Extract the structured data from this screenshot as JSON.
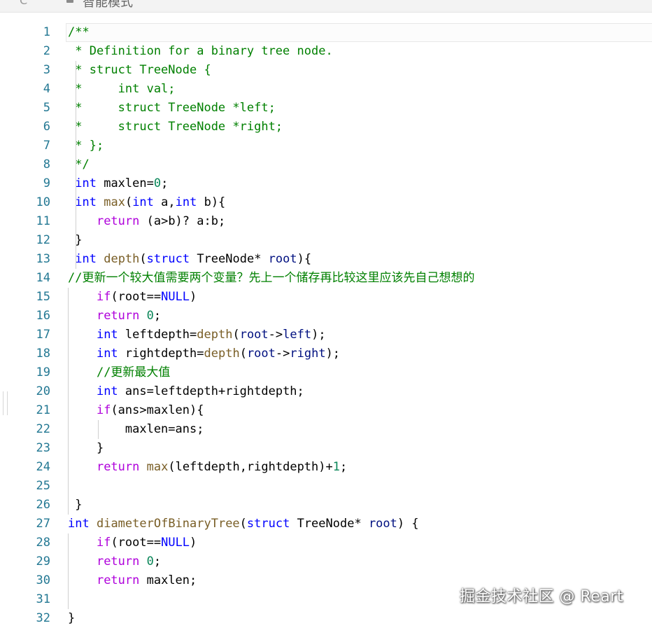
{
  "toolbar": {
    "back_glyph": "C",
    "mode_label": "智能模式"
  },
  "line_numbers": [
    "1",
    "2",
    "3",
    "4",
    "5",
    "6",
    "7",
    "8",
    "9",
    "10",
    "11",
    "12",
    "13",
    "14",
    "15",
    "16",
    "17",
    "18",
    "19",
    "20",
    "21",
    "22",
    "23",
    "24",
    "25",
    "26",
    "27",
    "28",
    "29",
    "30",
    "31",
    "32"
  ],
  "code_lines": [
    [
      {
        "t": "/**",
        "c": "cm"
      }
    ],
    [
      {
        "t": " * Definition for a binary tree node.",
        "c": "cm"
      }
    ],
    [
      {
        "t": " * struct TreeNode {",
        "c": "cm"
      }
    ],
    [
      {
        "t": " *     int val;",
        "c": "cm"
      }
    ],
    [
      {
        "t": " *     struct TreeNode *left;",
        "c": "cm"
      }
    ],
    [
      {
        "t": " *     struct TreeNode *right;",
        "c": "cm"
      }
    ],
    [
      {
        "t": " * };",
        "c": "cm"
      }
    ],
    [
      {
        "t": " */",
        "c": "cm"
      }
    ],
    [
      {
        "t": " "
      },
      {
        "t": "int",
        "c": "kw"
      },
      {
        "t": " maxlen="
      },
      {
        "t": "0",
        "c": "nu"
      },
      {
        "t": ";"
      }
    ],
    [
      {
        "t": " "
      },
      {
        "t": "int",
        "c": "kw"
      },
      {
        "t": " "
      },
      {
        "t": "max",
        "c": "fn"
      },
      {
        "t": "("
      },
      {
        "t": "int",
        "c": "kw"
      },
      {
        "t": " a,"
      },
      {
        "t": "int",
        "c": "kw"
      },
      {
        "t": " b){"
      }
    ],
    [
      {
        "t": "    "
      },
      {
        "t": "return",
        "c": "ck"
      },
      {
        "t": " (a>b)? a:b;"
      }
    ],
    [
      {
        "t": " }"
      }
    ],
    [
      {
        "t": " "
      },
      {
        "t": "int",
        "c": "kw"
      },
      {
        "t": " "
      },
      {
        "t": "depth",
        "c": "fn"
      },
      {
        "t": "("
      },
      {
        "t": "struct",
        "c": "kw"
      },
      {
        "t": " TreeNode* "
      },
      {
        "t": "root",
        "c": "va"
      },
      {
        "t": "){"
      }
    ],
    [
      {
        "t": "//更新一个较大值需要两个变量？先上一个储存再比较这里应该先自己想想的",
        "c": "cm"
      }
    ],
    [
      {
        "t": "    "
      },
      {
        "t": "if",
        "c": "ck"
      },
      {
        "t": "(root=="
      },
      {
        "t": "NULL",
        "c": "kw"
      },
      {
        "t": ")"
      }
    ],
    [
      {
        "t": "    "
      },
      {
        "t": "return",
        "c": "ck"
      },
      {
        "t": " "
      },
      {
        "t": "0",
        "c": "nu"
      },
      {
        "t": ";"
      }
    ],
    [
      {
        "t": "    "
      },
      {
        "t": "int",
        "c": "kw"
      },
      {
        "t": " leftdepth="
      },
      {
        "t": "depth",
        "c": "fn"
      },
      {
        "t": "("
      },
      {
        "t": "root",
        "c": "va"
      },
      {
        "t": "->"
      },
      {
        "t": "left",
        "c": "va"
      },
      {
        "t": ");"
      }
    ],
    [
      {
        "t": "    "
      },
      {
        "t": "int",
        "c": "kw"
      },
      {
        "t": " rightdepth="
      },
      {
        "t": "depth",
        "c": "fn"
      },
      {
        "t": "("
      },
      {
        "t": "root",
        "c": "va"
      },
      {
        "t": "->"
      },
      {
        "t": "right",
        "c": "va"
      },
      {
        "t": ");"
      }
    ],
    [
      {
        "t": "    "
      },
      {
        "t": "//更新最大值",
        "c": "cm"
      }
    ],
    [
      {
        "t": "    "
      },
      {
        "t": "int",
        "c": "kw"
      },
      {
        "t": " ans=leftdepth+rightdepth;"
      }
    ],
    [
      {
        "t": "    "
      },
      {
        "t": "if",
        "c": "ck"
      },
      {
        "t": "(ans>maxlen){"
      }
    ],
    [
      {
        "t": "        maxlen=ans;"
      }
    ],
    [
      {
        "t": "    }"
      }
    ],
    [
      {
        "t": "    "
      },
      {
        "t": "return",
        "c": "ck"
      },
      {
        "t": " "
      },
      {
        "t": "max",
        "c": "fn"
      },
      {
        "t": "(leftdepth,rightdepth)+"
      },
      {
        "t": "1",
        "c": "nu"
      },
      {
        "t": ";"
      }
    ],
    [
      {
        "t": ""
      }
    ],
    [
      {
        "t": " }"
      }
    ],
    [
      {
        "t": "int",
        "c": "kw"
      },
      {
        "t": " "
      },
      {
        "t": "diameterOfBinaryTree",
        "c": "fn"
      },
      {
        "t": "("
      },
      {
        "t": "struct",
        "c": "kw"
      },
      {
        "t": " TreeNode* "
      },
      {
        "t": "root",
        "c": "va"
      },
      {
        "t": ") {"
      }
    ],
    [
      {
        "t": "    "
      },
      {
        "t": "if",
        "c": "ck"
      },
      {
        "t": "(root=="
      },
      {
        "t": "NULL",
        "c": "kw"
      },
      {
        "t": ")"
      }
    ],
    [
      {
        "t": "    "
      },
      {
        "t": "return",
        "c": "ck"
      },
      {
        "t": " "
      },
      {
        "t": "0",
        "c": "nu"
      },
      {
        "t": ";"
      }
    ],
    [
      {
        "t": "    "
      },
      {
        "t": "return",
        "c": "ck"
      },
      {
        "t": " maxlen;"
      }
    ],
    [
      {
        "t": ""
      }
    ],
    [
      {
        "t": "}"
      }
    ]
  ],
  "watermark": "掘金技术社区 @ Reart",
  "colors": {
    "line_number": "#237893",
    "comment": "#008000",
    "keyword": "#0000ff",
    "control": "#af00db",
    "function": "#795e26",
    "variable": "#001080",
    "number": "#098658"
  }
}
